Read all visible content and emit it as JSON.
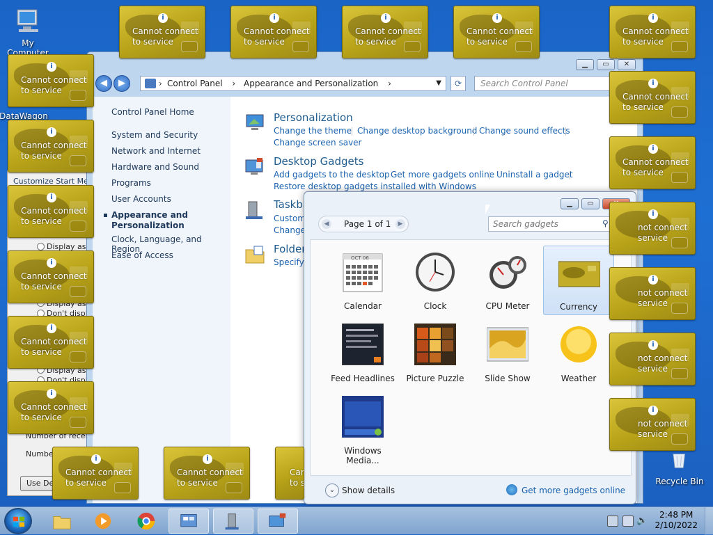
{
  "desktop": {
    "icons": [
      {
        "label": "My Computer"
      },
      {
        "label": "DataWagon"
      },
      {
        "label": "Recycle Bin"
      }
    ]
  },
  "control_panel": {
    "breadcrumb": [
      "Control Panel",
      "Appearance and Personalization"
    ],
    "search_placeholder": "Search Control Panel",
    "sidebar": [
      "Control Panel Home",
      "System and Security",
      "Network and Internet",
      "Hardware and Sound",
      "Programs",
      "User Accounts",
      "Appearance and Personalization",
      "Clock, Language, and Region",
      "Ease of Access"
    ],
    "categories": {
      "personalization": {
        "title": "Personalization",
        "links": [
          "Change the theme",
          "Change desktop background",
          "Change sound effects",
          "Change screen saver"
        ]
      },
      "gadgets": {
        "title": "Desktop Gadgets",
        "links": [
          "Add gadgets to the desktop",
          "Get more gadgets online",
          "Uninstall a gadget",
          "Restore desktop gadgets installed with Windows"
        ]
      },
      "taskbar": {
        "title": "Taskba",
        "links": [
          "Customi",
          "Change"
        ]
      },
      "folder": {
        "title": "Folder",
        "links": [
          "Specify s"
        ]
      }
    }
  },
  "behind_panel": {
    "title": "Customize Start Me",
    "items": [
      "Display as a",
      "Display as",
      "Don't displa",
      "Display as",
      "Don't displa",
      "Number of recent",
      "Number"
    ],
    "button": "Use Def"
  },
  "gadgets_window": {
    "page_label": "Page 1 of 1",
    "search_placeholder": "Search gadgets",
    "items": [
      "Calendar",
      "Clock",
      "CPU Meter",
      "Currency",
      "Feed Headlines",
      "Picture Puzzle",
      "Slide Show",
      "Weather",
      "Windows Media..."
    ],
    "selected": "Currency",
    "calendar_month": "OCT 06",
    "show_details": "Show details",
    "get_more": "Get more gadgets online"
  },
  "currency_gadget": {
    "info": "i",
    "line1": "Cannot connect",
    "line2": "to service",
    "partial_line1": "not connect",
    "partial_line2": "service",
    "bottom_partial_line1": "Can",
    "bottom_partial_line2": "to s"
  },
  "taskbar": {
    "time": "2:48 PM",
    "date": "2/10/2022"
  },
  "colors": {
    "desktop": "#1e6fd3",
    "link": "#1a62b0",
    "category_title": "#1e5c8f",
    "gadget_gold": "#c8b228"
  }
}
